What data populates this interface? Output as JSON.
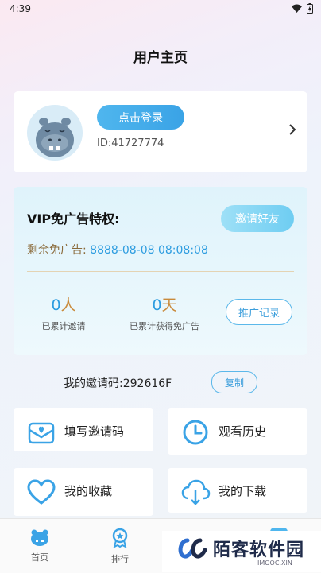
{
  "status": {
    "time": "4:39"
  },
  "page": {
    "title": "用户主页"
  },
  "profile": {
    "login_label": "点击登录",
    "user_id": "ID:41727774"
  },
  "vip": {
    "title": "VIP免广告特权:",
    "invite_label": "邀请好友",
    "remain_label": "剩余免广告:",
    "remain_value": "8888-08-08 08:08:08",
    "stats": [
      {
        "value": "0",
        "unit": "人",
        "label": "已累计邀请"
      },
      {
        "value": "0",
        "unit": "天",
        "label": "已累计获得免广告"
      }
    ],
    "record_label": "推广记录"
  },
  "invite_code": {
    "label": "我的邀请码:",
    "code": "292616F",
    "copy_label": "复制"
  },
  "menu": [
    {
      "label": "填写邀请码",
      "icon": "mail-icon"
    },
    {
      "label": "观看历史",
      "icon": "clock-icon"
    },
    {
      "label": "我的收藏",
      "icon": "heart-icon"
    },
    {
      "label": "我的下载",
      "icon": "cloud-download-icon"
    }
  ],
  "tabs": [
    {
      "label": "首页",
      "icon": "home-icon"
    },
    {
      "label": "排行",
      "icon": "rank-icon"
    }
  ],
  "watermark": {
    "text": "陌客软件园",
    "sub": "IMOOC.XIN"
  },
  "colors": {
    "accent": "#3aa3e6",
    "gold": "#c98a3a",
    "brown": "#8a6a3a"
  }
}
